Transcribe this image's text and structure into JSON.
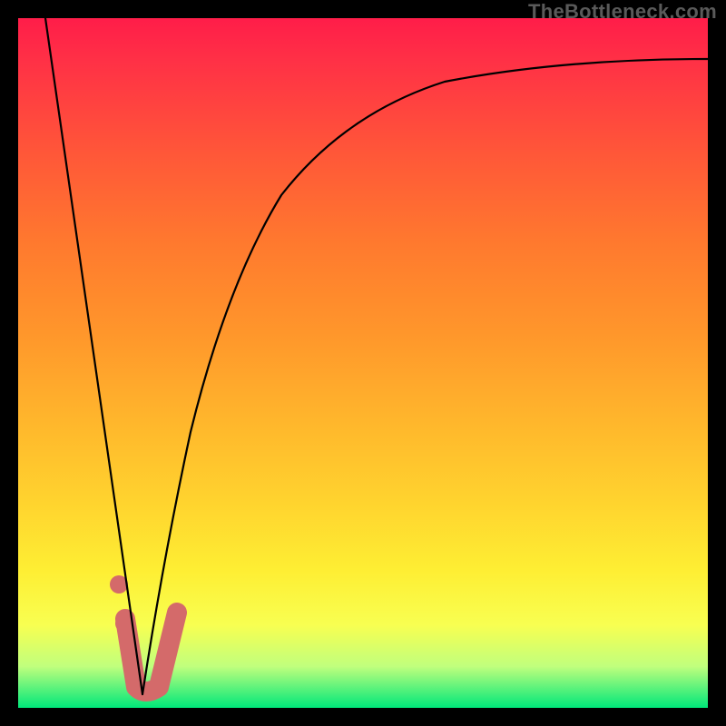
{
  "watermark": "TheBottleneck.com",
  "chart_data": {
    "type": "line",
    "title": "",
    "xlabel": "",
    "ylabel": "",
    "xlim": [
      0,
      100
    ],
    "ylim": [
      0,
      100
    ],
    "note": "Axes are unlabeled; x and y are normalized 0–100 across the plot area. y=0 at bottom (green), y=100 at top (red).",
    "series": [
      {
        "name": "left-descending-line",
        "x": [
          4,
          18
        ],
        "y": [
          100,
          2
        ]
      },
      {
        "name": "right-rising-curve",
        "x": [
          18,
          21,
          25,
          30,
          36,
          44,
          54,
          66,
          80,
          100
        ],
        "y": [
          2,
          22,
          40,
          55,
          67,
          77,
          84,
          89,
          92,
          94
        ]
      }
    ],
    "markers": [
      {
        "name": "highlight-j-curve",
        "x": [
          15.5,
          17,
          20,
          23
        ],
        "y": [
          13,
          3,
          3,
          14
        ]
      },
      {
        "name": "dot-upper",
        "x": 14.5,
        "y": 18
      },
      {
        "name": "dot-lower",
        "x": 15.3,
        "y": 12
      }
    ],
    "background_gradient": {
      "orientation": "vertical",
      "stops": [
        {
          "pos": 0.0,
          "color": "#ff1d49"
        },
        {
          "pos": 0.2,
          "color": "#ff5838"
        },
        {
          "pos": 0.46,
          "color": "#ff972b"
        },
        {
          "pos": 0.7,
          "color": "#ffd32e"
        },
        {
          "pos": 0.88,
          "color": "#f8ff51"
        },
        {
          "pos": 1.0,
          "color": "#00e77a"
        }
      ]
    }
  }
}
